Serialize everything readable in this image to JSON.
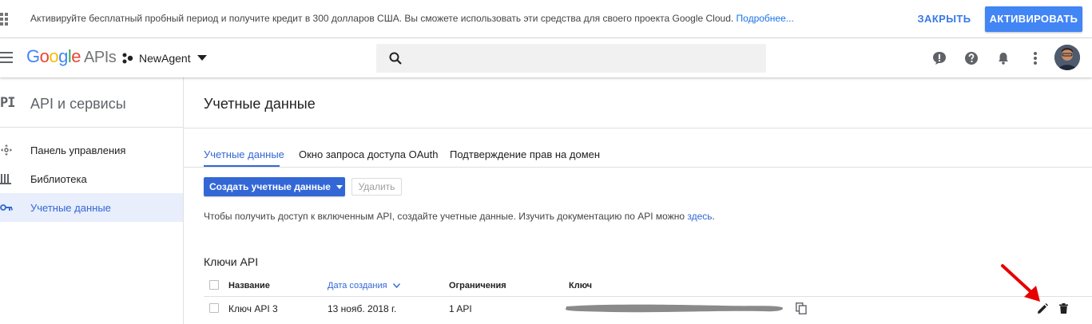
{
  "banner": {
    "message": "Активируйте бесплатный пробный период и получите кредит в 300 долларов США. Вы сможете использовать эти средства для своего проекта Google Cloud.",
    "link": "Подробнее...",
    "close_label": "ЗАКРЫТЬ",
    "activate_label": "АКТИВИРОВАТЬ"
  },
  "header": {
    "logo_google": [
      "G",
      "o",
      "o",
      "g",
      "l",
      "e"
    ],
    "logo_product": "APIs",
    "project": "NewAgent",
    "search_placeholder": "",
    "icons": [
      "feedback-icon",
      "help-icon",
      "notifications-icon",
      "more-vert-icon"
    ]
  },
  "sidebar": {
    "mark": "PI",
    "title": "API и сервисы",
    "items": [
      {
        "label": "Панель управления",
        "icon": "dashboard-icon",
        "active": false
      },
      {
        "label": "Библиотека",
        "icon": "library-icon",
        "active": false
      },
      {
        "label": "Учетные данные",
        "icon": "key-icon",
        "active": true
      }
    ]
  },
  "main": {
    "title": "Учетные данные",
    "tabs": [
      {
        "label": "Учетные данные",
        "active": true
      },
      {
        "label": "Окно запроса доступа OAuth",
        "active": false
      },
      {
        "label": "Подтверждение прав на домен",
        "active": false
      }
    ],
    "create_label": "Создать учетные данные",
    "delete_label": "Удалить",
    "help_text": "Чтобы получить доступ к включенным API, создайте учетные данные. Изучить документацию по API можно",
    "help_link": "здесь",
    "help_end": ".",
    "section_title": "Ключи API",
    "columns": [
      "Название",
      "Дата создания",
      "Ограничения",
      "Ключ"
    ],
    "rows": [
      {
        "name": "Ключ API 3",
        "created": "13 нояб. 2018 г.",
        "restrictions": "1 API",
        "key": ""
      }
    ]
  },
  "colors": {
    "accent": "#3367d6",
    "primary_button": "#4285f4",
    "annotation": "#e60000"
  }
}
